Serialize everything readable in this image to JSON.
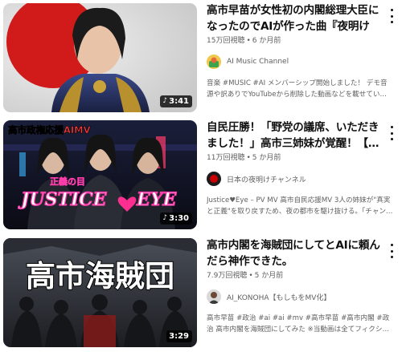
{
  "videos": [
    {
      "title": "高市早苗が女性初の内閣総理大臣になったのでAIが作った曲『夜明け",
      "views": "15万回視聴",
      "age": "6 か月前",
      "channel": "AI Music Channel",
      "description": "音楽 #MUSIC #AI メンバーシップ開始しました！ デモ音源や訳ありでYouTubeから削除した動画などを載せていく予定で…",
      "duration": "3:41",
      "thumb_text": []
    },
    {
      "title": "自民圧勝！「野党の議席、いただきました！」高市三姉妹が覚醒！【…",
      "views": "11万回視聴",
      "age": "5 か月前",
      "channel": "日本の夜明けチャンネル",
      "description": "Justice♥Eye – PV MV 高市自民応援MV 3人の姉妹が\"真実と正義\"を取り戻すため、夜の都市を駆け抜ける。「チャンネル…",
      "duration": "3:30",
      "thumb_text": [
        "高市政権応援AIMV",
        "正義の目",
        "JUSTICE",
        "EYE"
      ]
    },
    {
      "title": "高市内閣を海賊団にしてとAIに頼んだら神作できた。",
      "views": "7.9万回視聴",
      "age": "5 か月前",
      "channel": "AI_KONOHA【もしもをMV化】",
      "description": "高市早苗 #政治 #ai #ai #mv #高市早苗 #高市内閣 #政治 高市内閣を海賊団にしてみた ※当動画は全てフィクションであ…",
      "duration": "3:29",
      "thumb_text": [
        "高市海賊団"
      ]
    }
  ],
  "icons": {
    "more": "more-vert-icon",
    "shorts": "shorts-icon"
  },
  "colors": {
    "text": "#0f0f0f",
    "secondary": "#606060",
    "accent_red": "#cc0000",
    "pink": "#ff3cac"
  }
}
